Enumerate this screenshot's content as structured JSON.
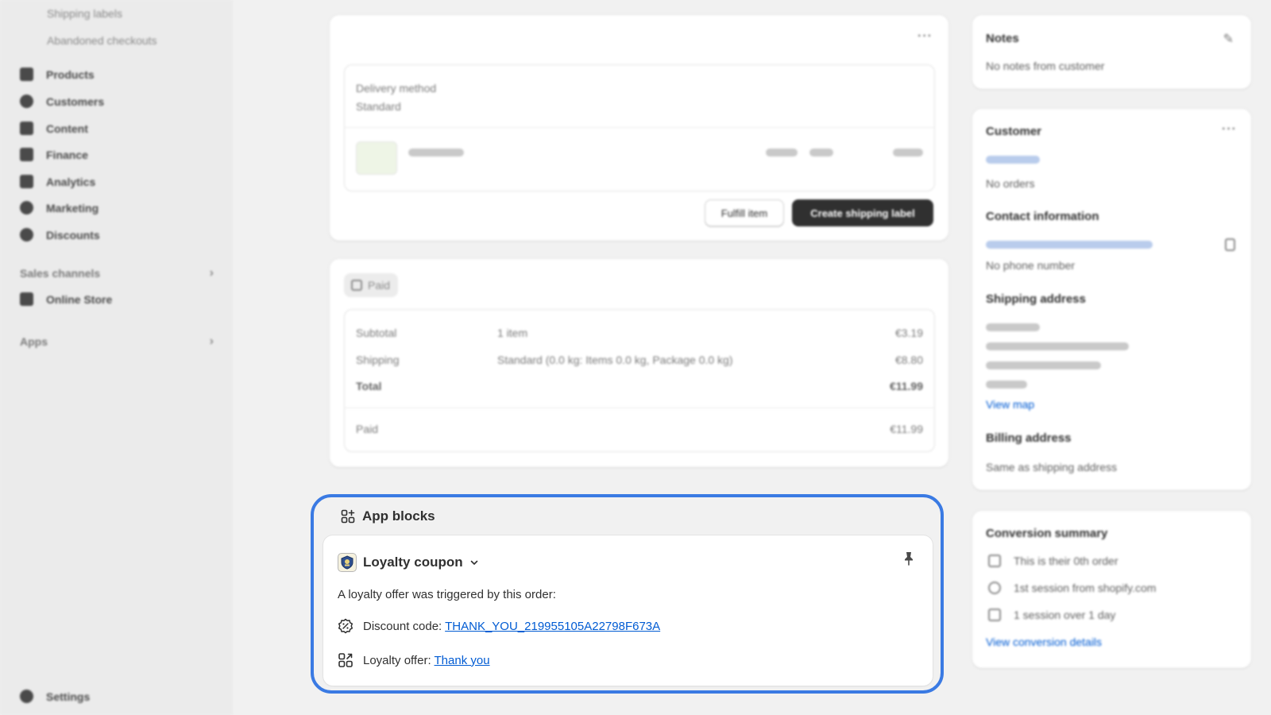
{
  "sidebar": {
    "sub_items": [
      "Shipping labels",
      "Abandoned checkouts"
    ],
    "items": [
      "Products",
      "Customers",
      "Content",
      "Finance",
      "Analytics",
      "Marketing",
      "Discounts"
    ],
    "sales_channels": "Sales channels",
    "online_store": "Online Store",
    "apps": "Apps",
    "settings": "Settings"
  },
  "fulfillment": {
    "delivery_label": "Delivery method",
    "delivery_value": "Standard",
    "fulfill_button": "Fulfill item",
    "create_label_button": "Create shipping label"
  },
  "payment": {
    "badge": "Paid",
    "subtotal_label": "Subtotal",
    "subtotal_desc": "1 item",
    "subtotal_value": "€3.19",
    "shipping_label": "Shipping",
    "shipping_desc": "Standard (0.0 kg: Items 0.0 kg, Package 0.0 kg)",
    "shipping_value": "€8.80",
    "total_label": "Total",
    "total_value": "€11.99",
    "paid_label": "Paid",
    "paid_value": "€11.99"
  },
  "notes": {
    "title": "Notes",
    "text": "No notes from customer"
  },
  "customer": {
    "title": "Customer",
    "orders": "No orders",
    "contact_title": "Contact information",
    "phone": "No phone number",
    "shipping_title": "Shipping address",
    "view_map": "View map",
    "billing_title": "Billing address",
    "billing_text": "Same as shipping address"
  },
  "conversion": {
    "title": "Conversion summary",
    "line1": "This is their 0th order",
    "line2": "1st session from shopify.com",
    "line3": "1 session over 1 day",
    "link": "View conversion details"
  },
  "app_blocks": {
    "title": "App blocks",
    "block_title": "Loyalty coupon",
    "description": "A loyalty offer was triggered by this order:",
    "discount_label": "Discount code: ",
    "discount_code": "THANK_YOU_219955105A22798F673A",
    "offer_label": "Loyalty offer: ",
    "offer_link": "Thank you"
  },
  "colors": {
    "accent": "#3a7ae3",
    "link": "#005bd3",
    "primary_button": "#303030"
  }
}
